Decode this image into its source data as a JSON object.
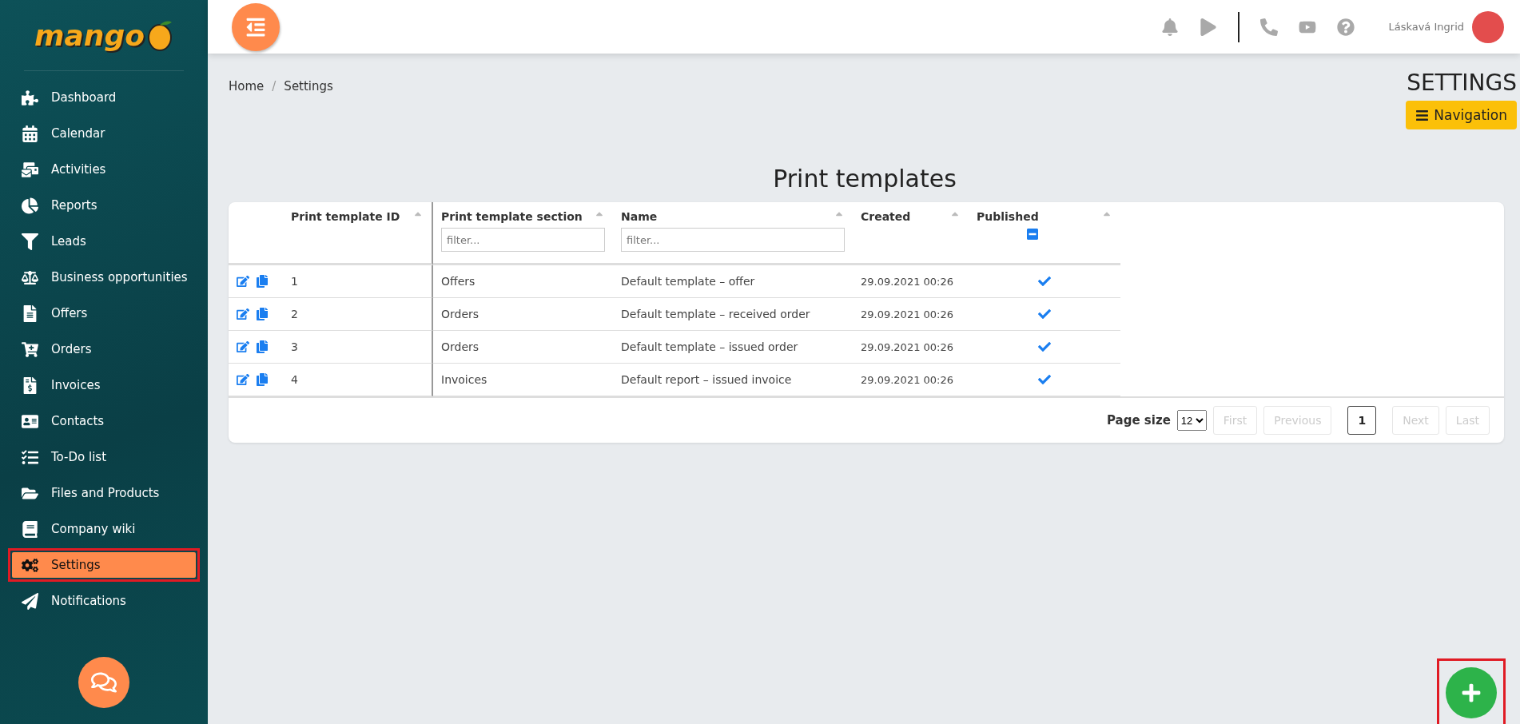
{
  "sidebar": {
    "logo": "mango",
    "items": [
      {
        "label": "Dashboard",
        "selected": false,
        "highlighted": false
      },
      {
        "label": "Calendar",
        "selected": false,
        "highlighted": false
      },
      {
        "label": "Activities",
        "selected": false,
        "highlighted": false
      },
      {
        "label": "Reports",
        "selected": false,
        "highlighted": false
      },
      {
        "label": "Leads",
        "selected": false,
        "highlighted": false
      },
      {
        "label": "Business opportunities",
        "selected": false,
        "highlighted": false
      },
      {
        "label": "Offers",
        "selected": false,
        "highlighted": false
      },
      {
        "label": "Orders",
        "selected": false,
        "highlighted": false
      },
      {
        "label": "Invoices",
        "selected": false,
        "highlighted": false
      },
      {
        "label": "Contacts",
        "selected": false,
        "highlighted": false
      },
      {
        "label": "To-Do list",
        "selected": false,
        "highlighted": false
      },
      {
        "label": "Files and Products",
        "selected": false,
        "highlighted": false
      },
      {
        "label": "Company wiki",
        "selected": false,
        "highlighted": false
      },
      {
        "label": "Settings",
        "selected": true,
        "highlighted": true
      },
      {
        "label": "Notifications",
        "selected": false,
        "highlighted": false
      }
    ]
  },
  "topbar": {
    "user_name": "Láskavá Ingrid"
  },
  "breadcrumb": [
    "Home",
    "Settings"
  ],
  "breadcrumb_separator": "/",
  "page_title": "SETTINGS",
  "navigation_button": "Navigation",
  "table": {
    "title": "Print templates",
    "columns": [
      {
        "label": "Print template ID",
        "kind": "plain"
      },
      {
        "label": "Print template section",
        "kind": "text_filter",
        "placeholder": "filter..."
      },
      {
        "label": "Name",
        "kind": "text_filter",
        "placeholder": "filter..."
      },
      {
        "label": "Created",
        "kind": "plain"
      },
      {
        "label": "Published",
        "kind": "checkbox_filter",
        "indeterminate": true
      }
    ],
    "rows": [
      {
        "id": "1",
        "section": "Offers",
        "name": "Default template – offer",
        "created": "29.09.2021 00:26",
        "published": true
      },
      {
        "id": "2",
        "section": "Orders",
        "name": "Default template – received order",
        "created": "29.09.2021 00:26",
        "published": true
      },
      {
        "id": "3",
        "section": "Orders",
        "name": "Default template – issued order",
        "created": "29.09.2021 00:26",
        "published": true
      },
      {
        "id": "4",
        "section": "Invoices",
        "name": "Default report – issued invoice",
        "created": "29.09.2021 00:26",
        "published": true
      }
    ],
    "pagination": {
      "page_size_label": "Page size",
      "page_size": "12",
      "buttons": [
        {
          "label": "First",
          "kind": "nav",
          "disabled": true
        },
        {
          "label": "Previous",
          "kind": "nav",
          "disabled": true
        },
        {
          "label": "1",
          "kind": "page",
          "selected": true
        },
        {
          "label": "Next",
          "kind": "nav",
          "disabled": true
        },
        {
          "label": "Last",
          "kind": "nav",
          "disabled": true
        }
      ]
    }
  },
  "add_button": {
    "highlighted": true
  }
}
